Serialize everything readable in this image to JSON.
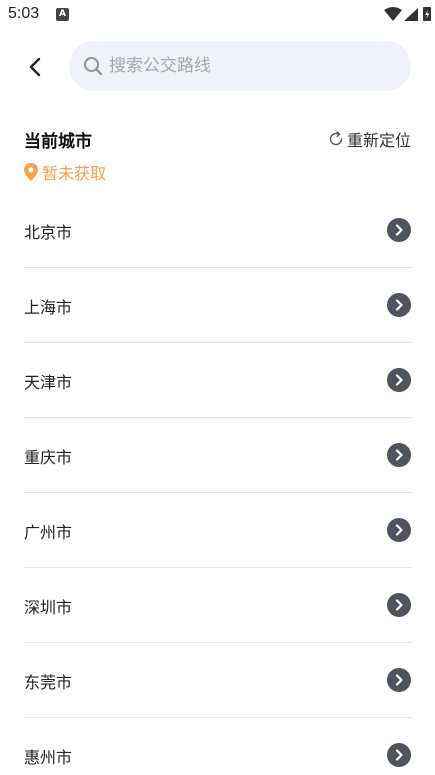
{
  "status_bar": {
    "time": "5:03",
    "notification_badge": "A"
  },
  "header": {
    "search_placeholder": "搜索公交路线"
  },
  "current_city": {
    "title": "当前城市",
    "relocate_label": "重新定位",
    "location_status": "暂未获取"
  },
  "colors": {
    "accent_orange": "#f5a04a",
    "search_bg": "#eff2f8",
    "arrow_bg": "#4f535c",
    "divider": "#e3e4e8"
  },
  "icons": {
    "back": "chevron-left-icon",
    "search": "search-icon",
    "relocate": "refresh-icon",
    "location": "map-pin-icon",
    "row_arrow": "chevron-right-circle-icon"
  },
  "cities": [
    {
      "name": "北京市"
    },
    {
      "name": "上海市"
    },
    {
      "name": "天津市"
    },
    {
      "name": "重庆市"
    },
    {
      "name": "广州市"
    },
    {
      "name": "深圳市"
    },
    {
      "name": "东莞市"
    },
    {
      "name": "惠州市"
    }
  ]
}
